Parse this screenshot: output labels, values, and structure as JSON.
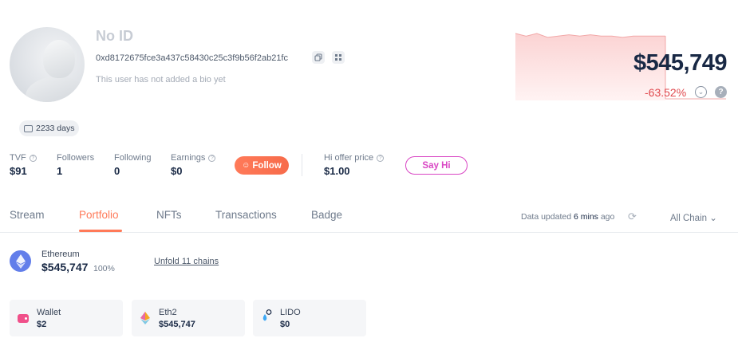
{
  "profile": {
    "name": "No ID",
    "address": "0xd8172675fce3a437c58430c25c3f9b56f2ab21fc",
    "bio": "This user has not added a bio yet",
    "days_badge": "2233 days"
  },
  "balance": {
    "value": "$545,749",
    "change": "-63.52%",
    "help_glyph": "?",
    "chart_trend": [
      1.0,
      0.99,
      1.0,
      0.985,
      0.99,
      0.995,
      0.99,
      0.995,
      0.99,
      0.99,
      0.985,
      0.99,
      0.99,
      0.99,
      0.99
    ],
    "colors": {
      "chart_fill": "#fde3e3",
      "chart_line": "#f2a8a8",
      "negative": "#e0484d"
    }
  },
  "stats": [
    {
      "label": "TVF",
      "value": "$91",
      "has_info": true
    },
    {
      "label": "Followers",
      "value": "1",
      "has_info": false
    },
    {
      "label": "Following",
      "value": "0",
      "has_info": false
    },
    {
      "label": "Earnings",
      "value": "$0",
      "has_info": true
    }
  ],
  "follow_button": "Follow",
  "hi_offer": {
    "label": "Hi offer price",
    "value": "$1.00"
  },
  "say_hi_button": "Say Hi",
  "tabs": [
    {
      "label": "Stream",
      "active": false
    },
    {
      "label": "Portfolio",
      "active": true
    },
    {
      "label": "NFTs",
      "active": false
    },
    {
      "label": "Transactions",
      "active": false
    },
    {
      "label": "Badge",
      "active": false
    }
  ],
  "data_updated": {
    "prefix": "Data updated",
    "time": "6 mins",
    "suffix": "ago"
  },
  "chain_filter": "All Chain",
  "chain_summary": {
    "name": "Ethereum",
    "value": "$545,747",
    "percent": "100%",
    "unfold_link": "Unfold 11 chains"
  },
  "protocols": [
    {
      "name": "Wallet",
      "value": "$2",
      "icon": "wallet-icon"
    },
    {
      "name": "Eth2",
      "value": "$545,747",
      "icon": "eth2-icon"
    },
    {
      "name": "LIDO",
      "value": "$0",
      "icon": "lido-icon"
    }
  ],
  "accent_colors": {
    "orange": "#ff7a59",
    "magenta": "#d946c4",
    "eth_blue": "#627eea"
  }
}
